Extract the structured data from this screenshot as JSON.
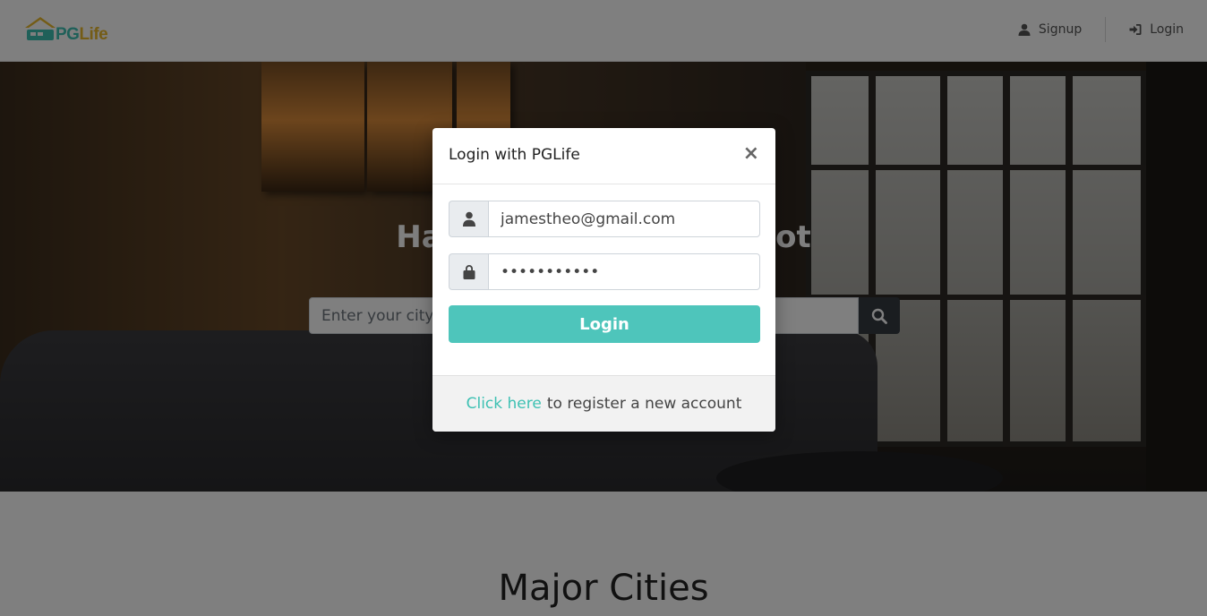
{
  "header": {
    "logo_text_pg": "PG",
    "logo_text_life": "Life",
    "nav": {
      "signup_label": "Signup",
      "login_label": "Login"
    }
  },
  "hero": {
    "title": "Happy Stay, Happy Spot",
    "search_placeholder": "Enter your city to search for PGs"
  },
  "main": {
    "section_title": "Major Cities"
  },
  "modal": {
    "title": "Login with PGLife",
    "close_symbol": "×",
    "email_value": "jamestheo@gmail.com",
    "password_value": "•••••••••••",
    "login_button_label": "Login",
    "footer_link_text": "Click here",
    "footer_text": "to register a new account"
  },
  "colors": {
    "accent": "#4ec5bb",
    "logo_pg": "#3ec1b3",
    "logo_life": "#e8b82c"
  }
}
